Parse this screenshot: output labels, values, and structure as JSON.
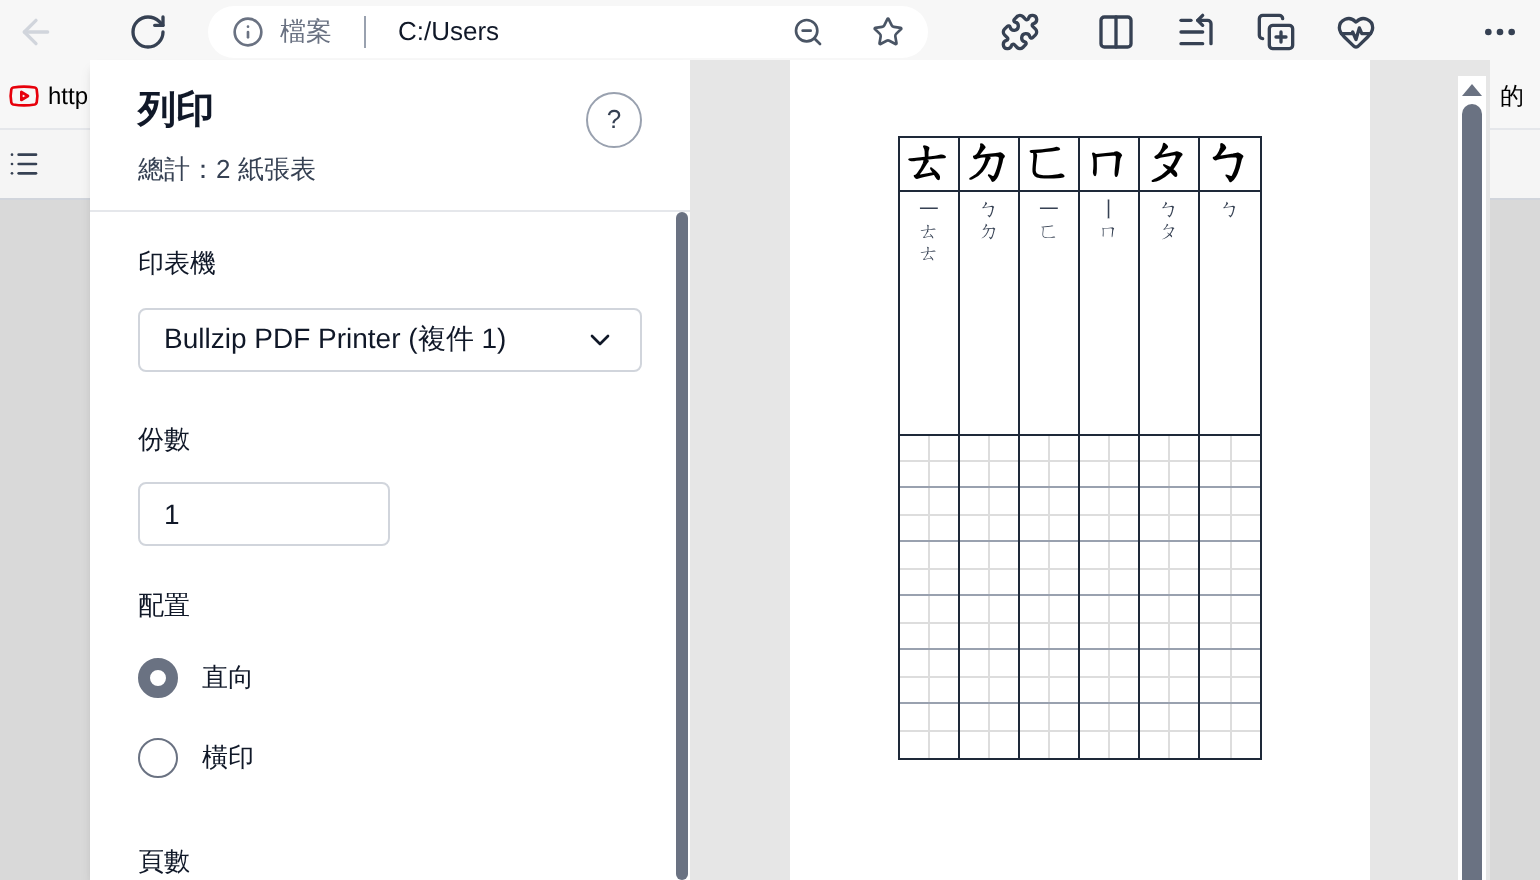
{
  "browser": {
    "address_bar": {
      "site_label": "檔案",
      "url": "C:/Users"
    },
    "bookmark_text": "http",
    "right_text": "的"
  },
  "print_dialog": {
    "title": "列印",
    "subtitle": "總計：2 紙張表",
    "help": "?",
    "printer": {
      "label": "印表機",
      "value": "Bullzip PDF Printer (複件 1)"
    },
    "copies": {
      "label": "份數",
      "value": "1"
    },
    "layout": {
      "label": "配置",
      "options": [
        {
          "label": "直向",
          "selected": true
        },
        {
          "label": "橫印",
          "selected": false
        }
      ]
    },
    "pages": {
      "label": "頁數"
    }
  },
  "preview": {
    "columns": [
      {
        "char": "ㄊ",
        "strokes": "一ㄊㄊ"
      },
      {
        "char": "ㄉ",
        "strokes": "ㄅㄉ"
      },
      {
        "char": "ㄈ",
        "strokes": "一ㄈ"
      },
      {
        "char": "ㄇ",
        "strokes": "丨ㄇ"
      },
      {
        "char": "ㄆ",
        "strokes": "ㄅㄆ"
      },
      {
        "char": "ㄅ",
        "strokes": "ㄅ"
      }
    ]
  }
}
